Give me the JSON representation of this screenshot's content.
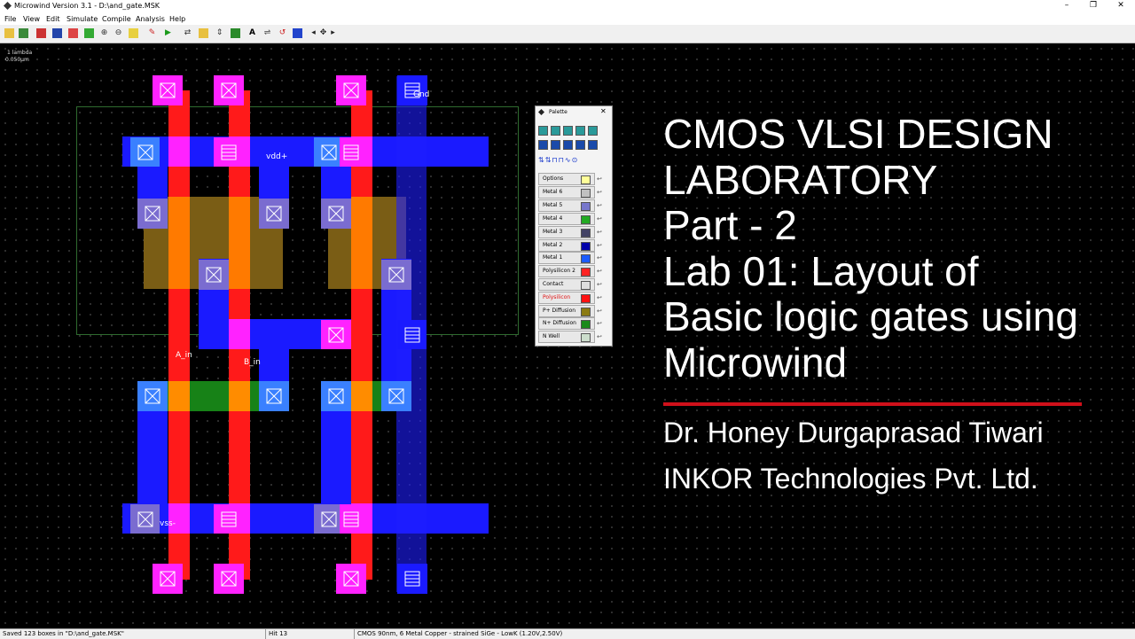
{
  "window": {
    "title": "Microwind Version 3.1 - D:\\and_gate.MSK",
    "controls": [
      "–",
      "❐",
      "✕"
    ]
  },
  "menu": [
    "File",
    "View",
    "Edit",
    "Simulate",
    "Compile",
    "Analysis",
    "Help"
  ],
  "toolbar": [
    "open-icon",
    "save-icon",
    "new-icon",
    "layer-icon",
    "zoom-in-icon",
    "zoom-out-icon",
    "view-icon",
    "measure-icon",
    "run-icon",
    "move-icon",
    "copy-icon",
    "stretch-icon",
    "text-icon",
    "flip-icon",
    "rotate-icon",
    "navigate-icon"
  ],
  "scale": {
    "label": "1 lambda",
    "value": "0.050µm"
  },
  "layout": {
    "labels": {
      "gnd": "Gnd",
      "vdd": "vdd+",
      "a_in": "A_in",
      "b_in": "B_in",
      "vss": "vss-"
    },
    "colors": {
      "metal1": "#1c1cff",
      "polysilicon": "#ff1a1a",
      "pdiff": "#8b6a12",
      "ndiff": "#1a8a1a",
      "contact": "#ff22ff"
    }
  },
  "palette": {
    "title": "Palette",
    "layers": [
      {
        "name": "Options",
        "color": "#ffff99"
      },
      {
        "name": "Metal 6",
        "color": "#c0c0c0"
      },
      {
        "name": "Metal 5",
        "color": "#7777cc"
      },
      {
        "name": "Metal 4",
        "color": "#22aa22"
      },
      {
        "name": "Metal 3",
        "color": "#444466"
      },
      {
        "name": "Metal 2",
        "color": "#0000aa"
      },
      {
        "name": "Metal 1",
        "color": "#1c5cff"
      },
      {
        "name": "Polysilicon 2",
        "color": "#ff2222"
      },
      {
        "name": "Contact",
        "color": "#dddddd"
      },
      {
        "name": "Polysilicon",
        "color": "#ff1111"
      },
      {
        "name": "P+ Diffusion",
        "color": "#8b7a12"
      },
      {
        "name": "N+ Diffusion",
        "color": "#1a8a1a"
      },
      {
        "name": "N Well",
        "color": "#ccddcc"
      }
    ]
  },
  "slide": {
    "title_lines": [
      "CMOS VLSI DESIGN",
      "LABORATORY",
      "Part - 2",
      "Lab 01: Layout of",
      "Basic logic gates using",
      "Microwind"
    ],
    "author": "Dr. Honey Durgaprasad Tiwari",
    "organization": "INKOR Technologies  Pvt. Ltd."
  },
  "status": {
    "saved": "Saved 123 boxes in \"D:\\and_gate.MSK\"",
    "hit": "Hit 13",
    "tech": "CMOS 90nm, 6 Metal Copper - strained SiGe - LowK (1.20V,2.50V)"
  }
}
